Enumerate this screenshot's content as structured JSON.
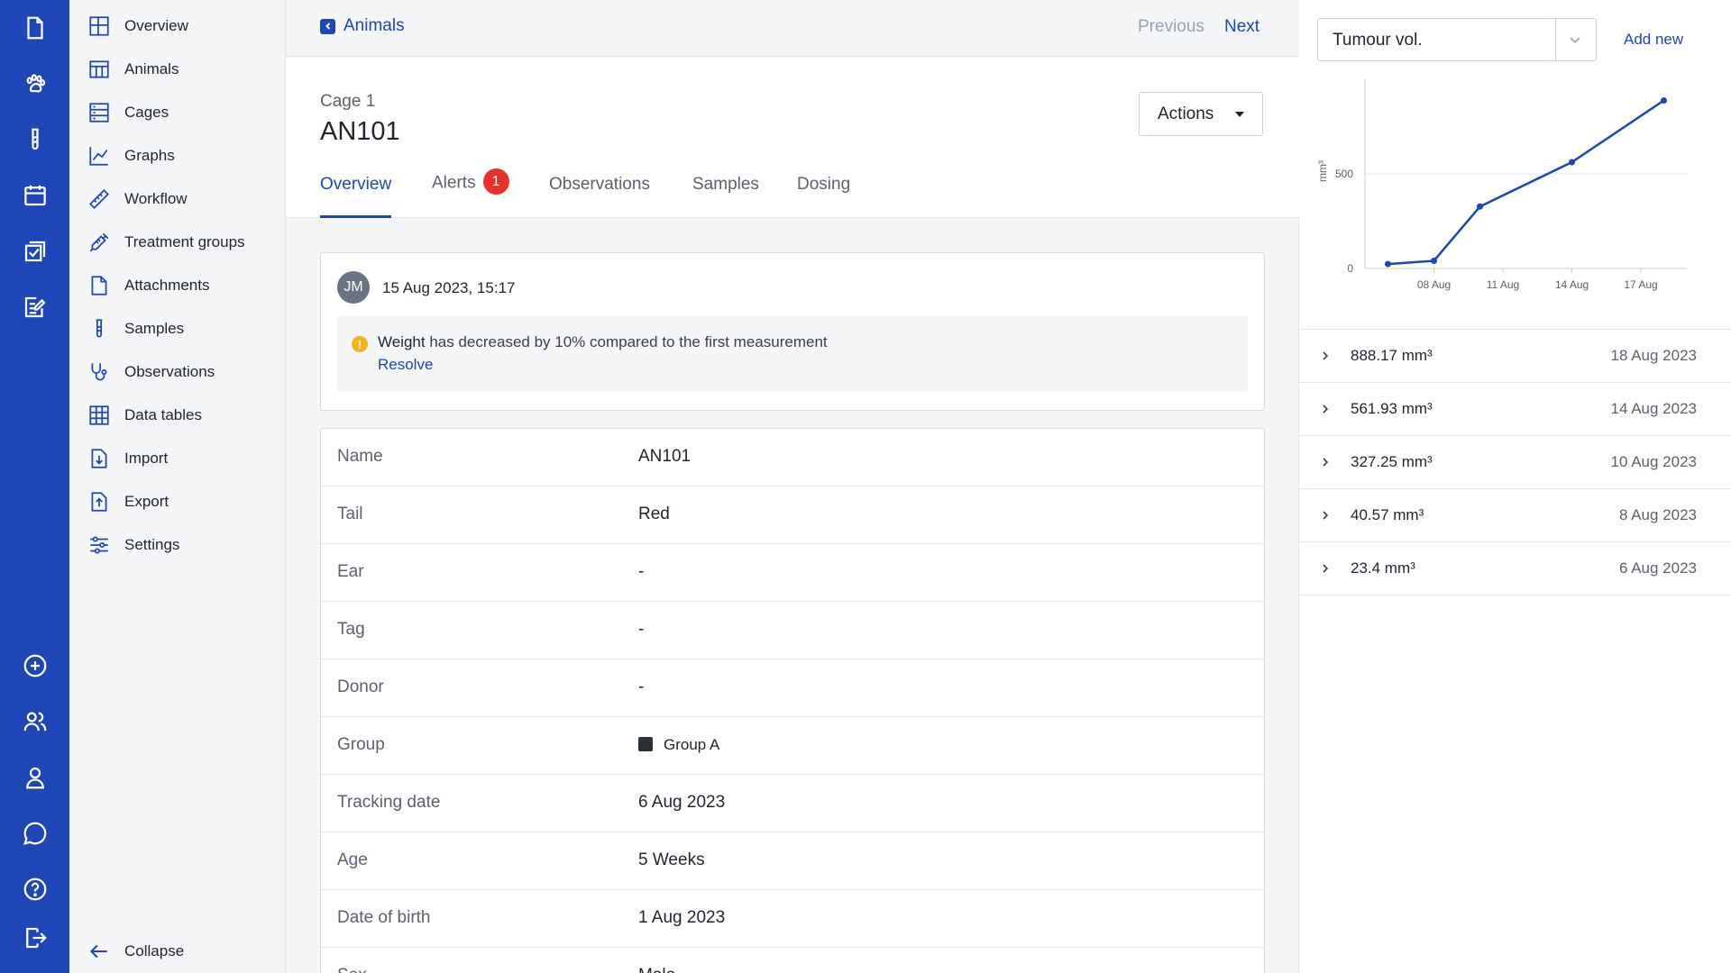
{
  "rail": {
    "top_icons": [
      "document-icon",
      "paw-icon",
      "test-tube-icon",
      "calendar-icon",
      "checklist-icon",
      "edit-note-icon"
    ],
    "bottom_icons": [
      "plus-circle-icon",
      "users-icon",
      "user-icon",
      "chat-icon",
      "help-icon",
      "logout-icon"
    ]
  },
  "sidebar": {
    "items": [
      {
        "label": "Overview",
        "icon": "layout-icon"
      },
      {
        "label": "Animals",
        "icon": "table-columns-icon"
      },
      {
        "label": "Cages",
        "icon": "cages-icon"
      },
      {
        "label": "Graphs",
        "icon": "line-chart-icon"
      },
      {
        "label": "Workflow",
        "icon": "ruler-icon"
      },
      {
        "label": "Treatment groups",
        "icon": "syringe-icon"
      },
      {
        "label": "Attachments",
        "icon": "file-icon"
      },
      {
        "label": "Samples",
        "icon": "test-tube-icon"
      },
      {
        "label": "Observations",
        "icon": "stethoscope-icon"
      },
      {
        "label": "Data tables",
        "icon": "grid-icon"
      },
      {
        "label": "Import",
        "icon": "import-icon"
      },
      {
        "label": "Export",
        "icon": "export-icon"
      },
      {
        "label": "Settings",
        "icon": "sliders-icon"
      }
    ],
    "collapse_label": "Collapse"
  },
  "topbar": {
    "back_label": "Animals",
    "previous_label": "Previous",
    "next_label": "Next"
  },
  "header": {
    "cage": "Cage 1",
    "animal": "AN101",
    "actions_label": "Actions",
    "tabs": [
      {
        "label": "Overview",
        "active": true
      },
      {
        "label": "Alerts",
        "badge": "1"
      },
      {
        "label": "Observations"
      },
      {
        "label": "Samples"
      },
      {
        "label": "Dosing"
      }
    ]
  },
  "alert": {
    "avatar_initials": "JM",
    "timestamp": "15 Aug 2023, 15:17",
    "metric": "Weight",
    "message": " has decreased by 10% compared to the first measurement",
    "resolve_label": "Resolve"
  },
  "details": [
    {
      "label": "Name",
      "value": "AN101"
    },
    {
      "label": "Tail",
      "value": "Red"
    },
    {
      "label": "Ear",
      "value": "-"
    },
    {
      "label": "Tag",
      "value": "-"
    },
    {
      "label": "Donor",
      "value": "-"
    },
    {
      "label": "Group",
      "value": "Group A",
      "swatch": "#2b2f36"
    },
    {
      "label": "Tracking date",
      "value": "6 Aug 2023"
    },
    {
      "label": "Age",
      "value": "5 Weeks"
    },
    {
      "label": "Date of birth",
      "value": "1 Aug 2023"
    },
    {
      "label": "Sex",
      "value": "Male"
    }
  ],
  "right_panel": {
    "metric_selected": "Tumour vol.",
    "add_new_label": "Add new",
    "measurements": [
      {
        "value": "888.17 mm³",
        "date": "18 Aug 2023"
      },
      {
        "value": "561.93 mm³",
        "date": "14 Aug 2023"
      },
      {
        "value": "327.25 mm³",
        "date": "10 Aug 2023"
      },
      {
        "value": "40.57 mm³",
        "date": "8 Aug 2023"
      },
      {
        "value": "23.4 mm³",
        "date": "6 Aug 2023"
      }
    ]
  },
  "chart_data": {
    "type": "line",
    "ylabel": "mm³",
    "x_ticks": [
      "08 Aug",
      "11 Aug",
      "14 Aug",
      "17 Aug"
    ],
    "y_ticks": [
      "0",
      "500"
    ],
    "x": [
      "2023-08-06",
      "2023-08-08",
      "2023-08-10",
      "2023-08-14",
      "2023-08-18"
    ],
    "values": [
      23.4,
      40.57,
      327.25,
      561.93,
      888.17
    ],
    "ylim": [
      0,
      1000
    ],
    "grid": true,
    "color": "#1d46b6"
  },
  "colors": {
    "brand": "#1d46b6",
    "alert_badge": "#e5332a",
    "warning": "#f5b31a"
  }
}
